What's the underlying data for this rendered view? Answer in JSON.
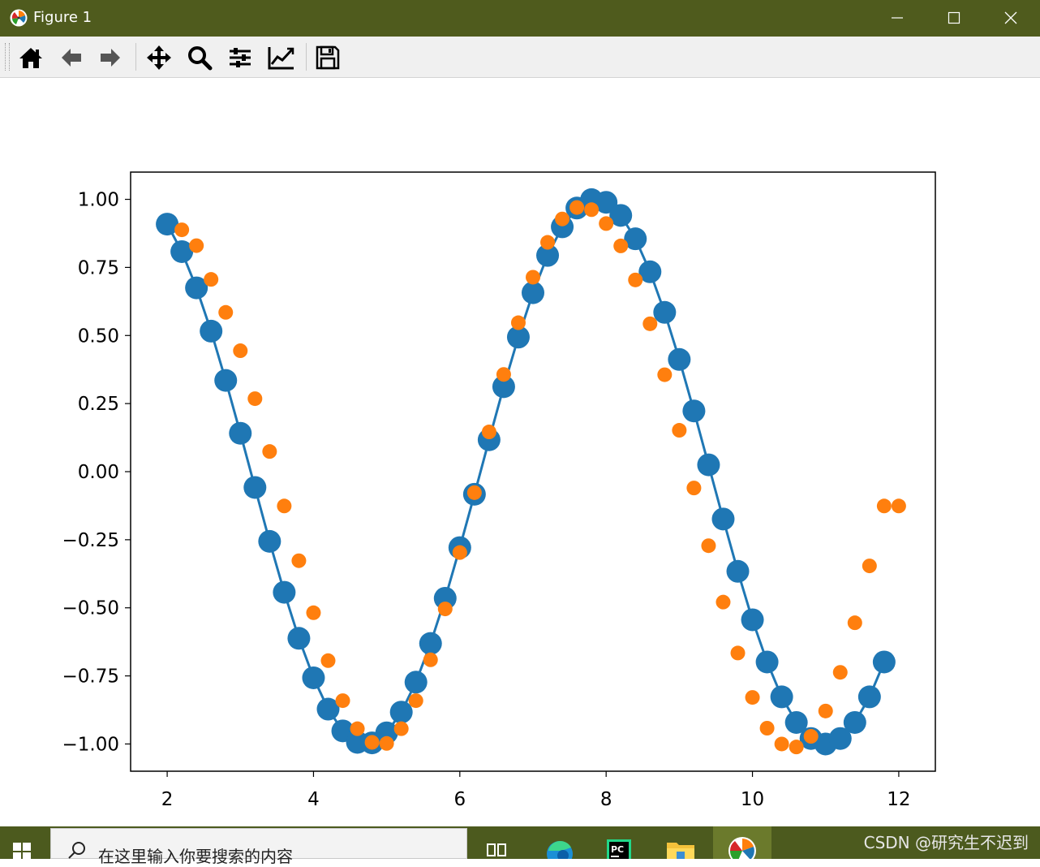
{
  "window": {
    "title": "Figure 1",
    "controls": [
      "minimize-icon",
      "maximize-icon",
      "close-icon"
    ]
  },
  "toolbar": {
    "tools": [
      {
        "icon": "home-icon",
        "label": "Home"
      },
      {
        "icon": "back-arrow-icon",
        "label": "Back"
      },
      {
        "icon": "forward-arrow-icon",
        "label": "Forward"
      },
      {
        "icon": "pan-icon",
        "label": "Pan"
      },
      {
        "icon": "zoom-icon",
        "label": "Zoom"
      },
      {
        "icon": "subplots-icon",
        "label": "Configure subplots"
      },
      {
        "icon": "edit-axis-icon",
        "label": "Edit axis"
      },
      {
        "icon": "save-icon",
        "label": "Save"
      }
    ]
  },
  "taskbar": {
    "search_placeholder": "在这里输入你要搜索的内容",
    "watermark": "CSDN @研究生不迟到"
  },
  "colors": {
    "titlebar": "#4f5b1d",
    "series_line": "#1f77b4",
    "series_dots": "#ff7f0e"
  },
  "chart_data": {
    "type": "line",
    "xlim": [
      1.5,
      12.5
    ],
    "ylim": [
      -1.1,
      1.1
    ],
    "xticks": [
      2,
      4,
      6,
      8,
      10,
      12
    ],
    "yticks": [
      1.0,
      0.75,
      0.5,
      0.25,
      0.0,
      -0.25,
      -0.5,
      -0.75,
      -1.0
    ],
    "ytick_labels": [
      "1.00",
      "0.75",
      "0.50",
      "0.25",
      "0.00",
      "−0.25",
      "−0.50",
      "−0.75",
      "−1.00"
    ],
    "xtick_labels": [
      "2",
      "4",
      "6",
      "8",
      "10",
      "12"
    ],
    "grid": false,
    "legend": "none",
    "series": [
      {
        "style": "line-with-large-markers",
        "color": "#1f77b4",
        "x": [
          2.0,
          2.2,
          2.4,
          2.6,
          2.8,
          3.0,
          3.2,
          3.4,
          3.6,
          3.8,
          4.0,
          4.2,
          4.4,
          4.6,
          4.8,
          5.0,
          5.2,
          5.4,
          5.6,
          5.8,
          6.0,
          6.2,
          6.4,
          6.6,
          6.8,
          7.0,
          7.2,
          7.4,
          7.6,
          7.8,
          8.0,
          8.2,
          8.4,
          8.6,
          8.8,
          9.0,
          9.2,
          9.4,
          9.6,
          9.8,
          10.0,
          10.2,
          10.4,
          10.6,
          10.8,
          11.0,
          11.2,
          11.4,
          11.6,
          11.8
        ],
        "y": [
          0.909,
          0.808,
          0.675,
          0.516,
          0.335,
          0.141,
          -0.058,
          -0.256,
          -0.443,
          -0.612,
          -0.757,
          -0.872,
          -0.952,
          -0.994,
          -0.996,
          -0.959,
          -0.883,
          -0.773,
          -0.631,
          -0.465,
          -0.279,
          -0.083,
          0.117,
          0.312,
          0.494,
          0.657,
          0.794,
          0.899,
          0.968,
          0.999,
          0.989,
          0.941,
          0.855,
          0.734,
          0.585,
          0.412,
          0.223,
          0.025,
          -0.174,
          -0.366,
          -0.544,
          -0.699,
          -0.827,
          -0.921,
          -0.98,
          -1.0,
          -0.98,
          -0.921,
          -0.827,
          -0.699
        ]
      },
      {
        "style": "scatter",
        "color": "#ff7f0e",
        "x": [
          2.2,
          2.4,
          2.6,
          2.8,
          3.0,
          3.2,
          3.4,
          3.6,
          3.8,
          4.0,
          4.2,
          4.4,
          4.6,
          4.8,
          5.0,
          5.2,
          5.4,
          5.6,
          5.8,
          6.0,
          6.2,
          6.4,
          6.6,
          6.8,
          7.0,
          7.2,
          7.4,
          7.6,
          7.8,
          8.0,
          8.2,
          8.4,
          8.6,
          8.8,
          9.0,
          9.2,
          9.4,
          9.6,
          9.8,
          10.0,
          10.2,
          10.4,
          10.6,
          10.8,
          11.0,
          11.2,
          11.4,
          11.6,
          11.8,
          12.0
        ],
        "y": [
          0.888,
          0.83,
          0.706,
          0.585,
          0.444,
          0.268,
          0.074,
          -0.126,
          -0.327,
          -0.518,
          -0.694,
          -0.841,
          -0.944,
          -0.994,
          -0.998,
          -0.944,
          -0.841,
          -0.691,
          -0.504,
          -0.297,
          -0.077,
          0.146,
          0.357,
          0.547,
          0.714,
          0.842,
          0.928,
          0.97,
          0.962,
          0.911,
          0.829,
          0.704,
          0.543,
          0.356,
          0.152,
          -0.06,
          -0.272,
          -0.479,
          -0.666,
          -0.829,
          -0.942,
          -1.0,
          -1.011,
          -0.972,
          -0.879,
          -0.737,
          -0.555,
          -0.346,
          -0.126,
          -0.126
        ]
      }
    ]
  }
}
